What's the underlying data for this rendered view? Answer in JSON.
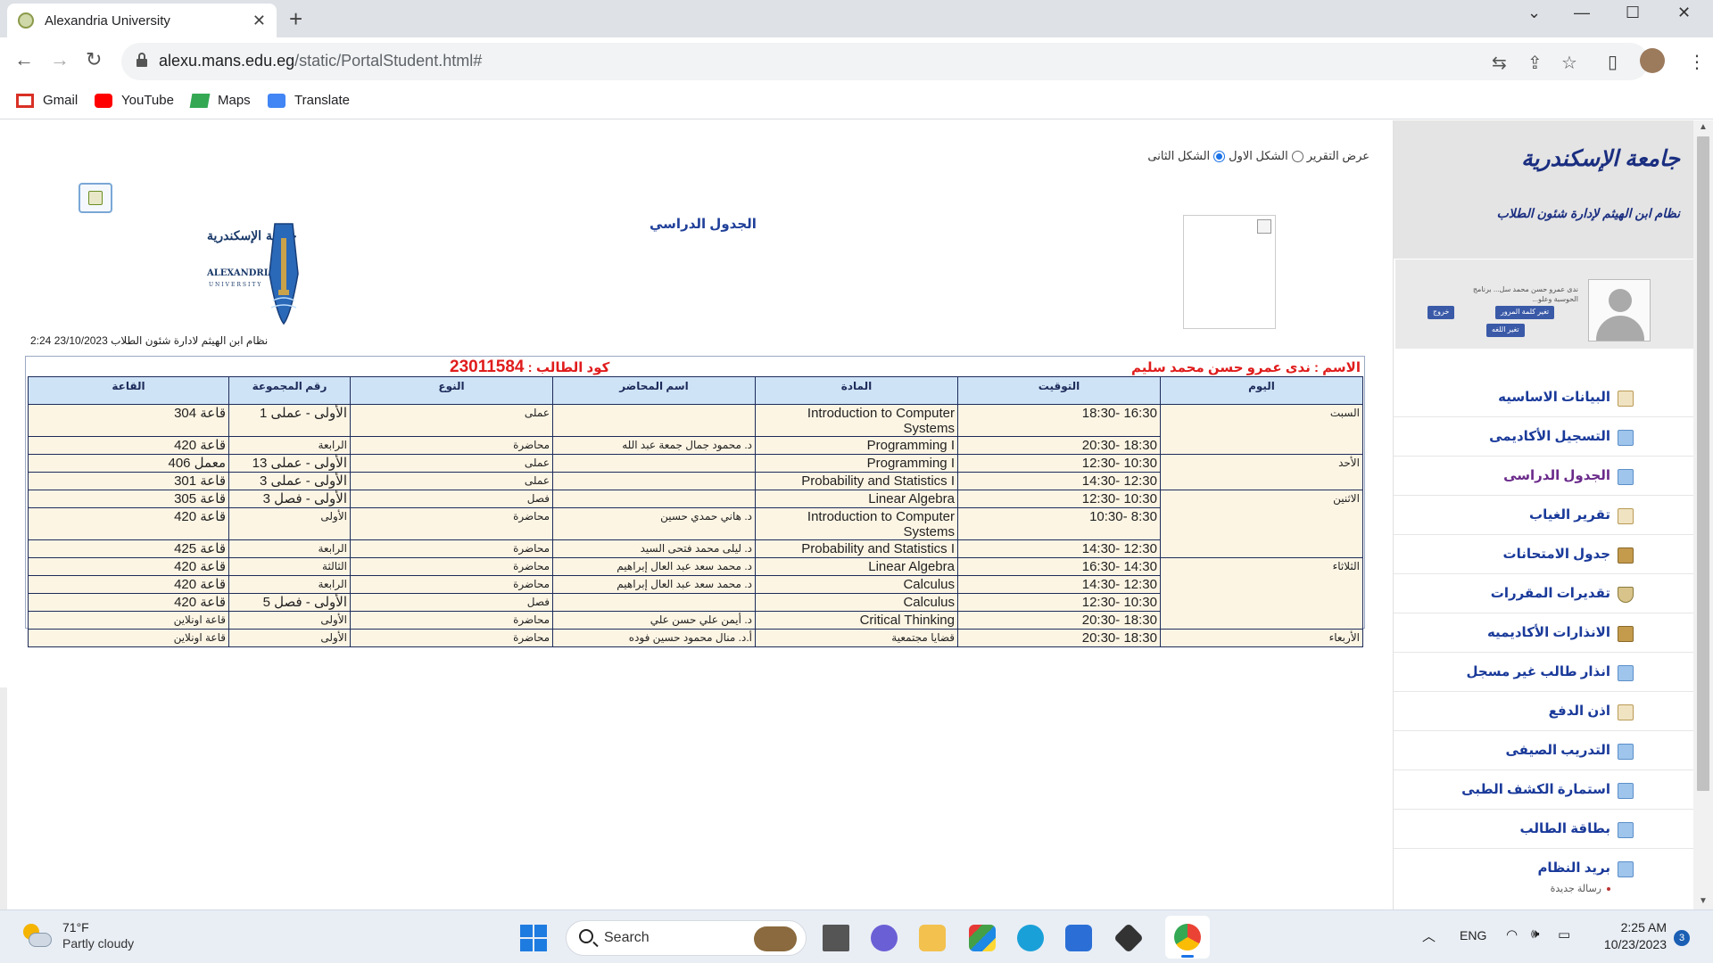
{
  "browser": {
    "tab_title": "Alexandria University",
    "close_tab": "✕",
    "new_tab": "+",
    "url_host": "alexu.mans.edu.eg",
    "url_path": "/static/PortalStudent.html#",
    "window": {
      "minimize": "—",
      "maximize": "☐",
      "close": "✕",
      "dropdown": "⌄"
    },
    "bookmarks": [
      {
        "label": "Gmail",
        "icon": "gmail-icon",
        "color": "#d93025"
      },
      {
        "label": "YouTube",
        "icon": "youtube-icon",
        "color": "#ff0000"
      },
      {
        "label": "Maps",
        "icon": "maps-icon",
        "color": "#34a853"
      },
      {
        "label": "Translate",
        "icon": "translate-icon",
        "color": "#4285f4"
      }
    ]
  },
  "report": {
    "options_label": "عرض التقرير",
    "option_first": "الشكل الاول",
    "option_second": "الشكل الثانى",
    "title": "الجدول الدراسي",
    "meta": "نظام ابن الهيثم لادارة شئون الطلاب 23/10/2023 2:24",
    "student_name": "الاسم : ندى عمرو حسن محمد سليم",
    "student_code_label": "كود الطالب : ",
    "student_code": "23011584",
    "logo_text": "ALEXANDRIA UNIVERSITY"
  },
  "schedule": {
    "headers": [
      "اليوم",
      "التوقيت",
      "المادة",
      "اسم المحاضر",
      "النوع",
      "رقم المجموعة",
      "القاعة"
    ],
    "rows": [
      {
        "day": "السبت",
        "time": "16:30 -18:30",
        "course": "Introduction to Computer Systems",
        "lecturer": "",
        "type": "عملى",
        "group": "الأولى - عملى 1",
        "room": "قاعة 304"
      },
      {
        "day": "",
        "time": "18:30 -20:30",
        "course": "Programming I",
        "lecturer": "د. محمود جمال جمعة عبد الله",
        "type": "محاضرة",
        "group": "الرابعة",
        "room": "قاعة 420"
      },
      {
        "day": "الأحد",
        "time": "10:30 -12:30",
        "course": "Programming I",
        "lecturer": "",
        "type": "عملى",
        "group": "الأولى - عملى 13",
        "room": "معمل 406"
      },
      {
        "day": "",
        "time": "12:30 -14:30",
        "course": "Probability and Statistics I",
        "lecturer": "",
        "type": "عملى",
        "group": "الأولى - عملى 3",
        "room": "قاعة 301"
      },
      {
        "day": "الاثنين",
        "time": "10:30 -12:30",
        "course": "Linear Algebra",
        "lecturer": "",
        "type": "فصل",
        "group": "الأولى - فصل 3",
        "room": "قاعة 305"
      },
      {
        "day": "",
        "time": "8:30 -10:30",
        "course": "Introduction to Computer Systems",
        "lecturer": "د. هاني حمدي حسين",
        "type": "محاضرة",
        "group": "الأولى",
        "room": "قاعة 420"
      },
      {
        "day": "",
        "time": "12:30 -14:30",
        "course": "Probability and Statistics I",
        "lecturer": "د. ليلى محمد فتحى السيد",
        "type": "محاضرة",
        "group": "الرابعة",
        "room": "قاعة 425"
      },
      {
        "day": "الثلاثاء",
        "time": "14:30 -16:30",
        "course": "Linear Algebra",
        "lecturer": "د. محمد سعد عبد العال إبراهيم",
        "type": "محاضرة",
        "group": "الثالثة",
        "room": "قاعة 420"
      },
      {
        "day": "",
        "time": "12:30 -14:30",
        "course": "Calculus",
        "lecturer": "د. محمد سعد عبد العال إبراهيم",
        "type": "محاضرة",
        "group": "الرابعة",
        "room": "قاعة 420"
      },
      {
        "day": "",
        "time": "10:30 -12:30",
        "course": "Calculus",
        "lecturer": "",
        "type": "فصل",
        "group": "الأولى - فصل 5",
        "room": "قاعة 420"
      },
      {
        "day": "",
        "time": "18:30 -20:30",
        "course": "Critical Thinking",
        "lecturer": "د. أيمن علي حسن علي",
        "type": "محاضرة",
        "group": "الأولى",
        "room": "قاعة اونلاين"
      },
      {
        "day": "الأربعاء",
        "time": "18:30 -20:30",
        "course": "قضايا مجتمعية",
        "lecturer": "أ.د. منال محمود حسين فوده",
        "type": "محاضرة",
        "group": "الأولى",
        "room": "قاعة اونلاين"
      }
    ]
  },
  "sidebar": {
    "university": "جامعة الإسكندرية",
    "system": "نظام ابن الهيثم لإدارة شئون الطلاب",
    "user_name": "ندى عمرو حسن محمد سل... برنامج الحوسبة وعلو...",
    "btn_change_password": "تغير كلمة المرور",
    "btn_logout": "خروج",
    "btn_language": "تغير اللغه",
    "menu": [
      {
        "label": "البيانات الاساسيه",
        "icon": "clipboard-icon"
      },
      {
        "label": "التسجيل الأكاديمى",
        "icon": "window-icon"
      },
      {
        "label": "الجدول الدراسى",
        "icon": "window-icon"
      },
      {
        "label": "تقرير الغياب",
        "icon": "clipboard-icon"
      },
      {
        "label": "جدول الامتحانات",
        "icon": "folder-icon"
      },
      {
        "label": "تقديرات المقررات",
        "icon": "trophy-icon"
      },
      {
        "label": "الانذارات الأكاديميه",
        "icon": "folder-icon"
      },
      {
        "label": "انذار طالب غير مسجل",
        "icon": "window-icon"
      },
      {
        "label": "اذن الدفع",
        "icon": "clipboard-icon"
      },
      {
        "label": "التدريب الصيفى",
        "icon": "window-icon"
      },
      {
        "label": "استمارة الكشف الطبى",
        "icon": "window-icon"
      },
      {
        "label": "بطاقة الطالب",
        "icon": "window-icon"
      },
      {
        "label": "بريد النظام",
        "icon": "mail-icon"
      }
    ],
    "mail_sub": "رسالة جديدة"
  },
  "taskbar": {
    "temp": "71°F",
    "weather": "Partly cloudy",
    "search": "Search",
    "lang": "ENG",
    "time": "2:25 AM",
    "date": "10/23/2023",
    "notifications": "3"
  }
}
